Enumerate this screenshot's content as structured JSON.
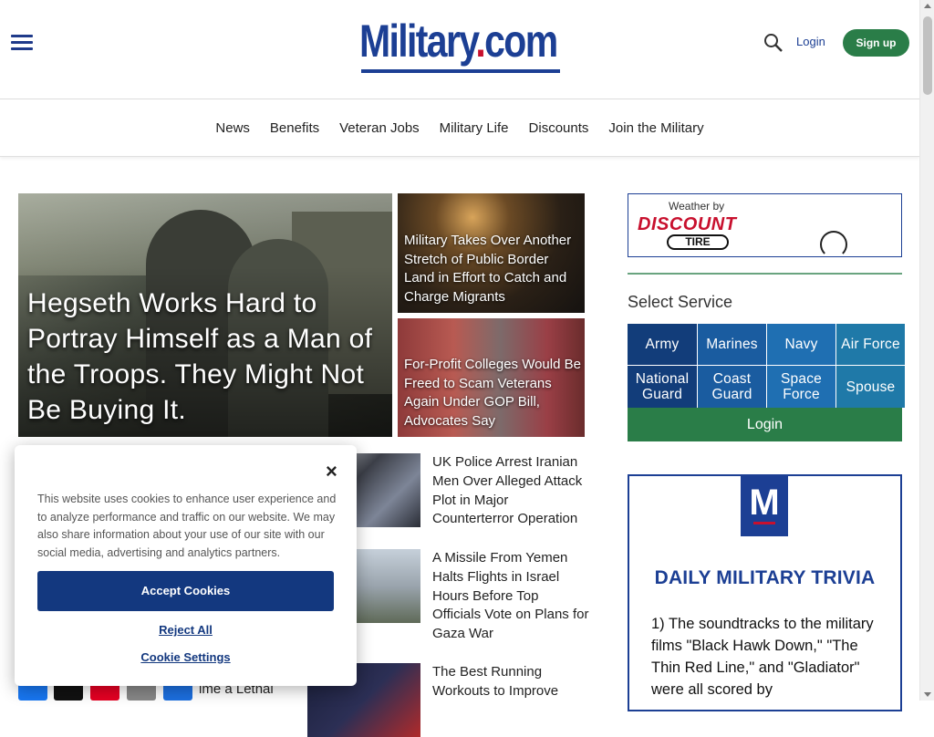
{
  "header": {
    "logo_text": "Military",
    "logo_dot": ".",
    "logo_suffix": "com",
    "login": "Login",
    "signup": "Sign up"
  },
  "nav": [
    "News",
    "Benefits",
    "Veteran Jobs",
    "Military Life",
    "Discounts",
    "Join the Military"
  ],
  "hero": {
    "title": "Hegseth Works Hard to Portray Himself as a Man of the Troops. They Might Not Be Buying It."
  },
  "cards": [
    {
      "title": "Military Takes Over Another Stretch of Public Border Land in Effort to Catch and Charge Migrants"
    },
    {
      "title": "For-Profit Colleges Would Be Freed to Scam Veterans Again Under GOP Bill, Advocates Say"
    }
  ],
  "list": [
    {
      "title": "UK Police Arrest Iranian Men Over Alleged Attack Plot in Major Counterterror Operation"
    },
    {
      "title": "A Missile From Yemen Halts Flights in Israel Hours Before Top Officials Vote on Plans for Gaza War"
    },
    {
      "title": "The Best Running Workouts to Improve"
    }
  ],
  "partial_text": "ime a Lethal",
  "cookie": {
    "text": "This website uses cookies to enhance user experience and to analyze performance and traffic on our website. We may also share information about your use of our site with our social media, advertising and analytics partners.",
    "accept": "Accept Cookies",
    "reject": "Reject All",
    "settings": "Cookie Settings",
    "close": "×"
  },
  "weather": {
    "by": "Weather by",
    "brand": "DISCOUNT",
    "brand2": "TIRE"
  },
  "service": {
    "title": "Select Service",
    "items": [
      "Army",
      "Marines",
      "Navy",
      "Air Force",
      "National Guard",
      "Coast Guard",
      "Space Force",
      "Spouse"
    ],
    "login": "Login"
  },
  "trivia": {
    "badge": "M",
    "title": "DAILY MILITARY TRIVIA",
    "question": "1) The soundtracks to the military films \"Black Hawk Down,\" \"The Thin Red Line,\" and \"Gladiator\" were all scored by"
  },
  "colors": {
    "brand_blue": "#1c3f94",
    "brand_red": "#c8102e",
    "green": "#2a7d48"
  }
}
